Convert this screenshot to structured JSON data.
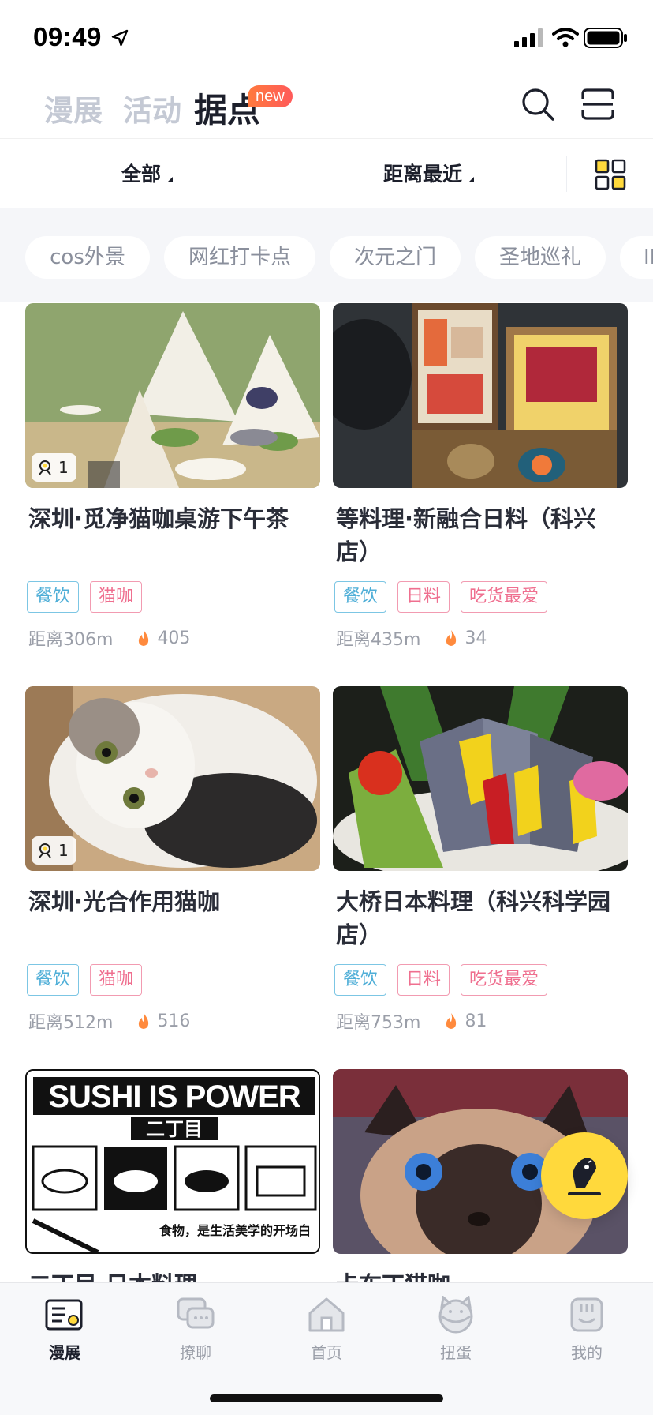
{
  "status_bar": {
    "time": "09:49"
  },
  "top_nav": {
    "tabs": [
      {
        "label": "漫展"
      },
      {
        "label": "活动"
      },
      {
        "label": "据点"
      }
    ],
    "new_badge": "new"
  },
  "filters": {
    "category": "全部",
    "sort": "距离最近"
  },
  "chips": [
    "cos外景",
    "网红打卡点",
    "次元之门",
    "圣地巡礼",
    "IP"
  ],
  "cards": [
    {
      "title": "深圳·觅净猫咖桌游下午茶",
      "badge": "1",
      "tags": [
        "餐饮",
        "猫咖"
      ],
      "distance": "距离306m",
      "heat": "405"
    },
    {
      "title": "等料理·新融合日料（科兴店）",
      "badge": "",
      "tags": [
        "餐饮",
        "日料",
        "吃货最爱"
      ],
      "distance": "距离435m",
      "heat": "34"
    },
    {
      "title": "深圳·光合作用猫咖",
      "badge": "1",
      "tags": [
        "餐饮",
        "猫咖"
      ],
      "distance": "距离512m",
      "heat": "516"
    },
    {
      "title": "大桥日本料理（科兴科学园店）",
      "badge": "",
      "tags": [
        "餐饮",
        "日料",
        "吃货最爱"
      ],
      "distance": "距离753m",
      "heat": "81"
    },
    {
      "title": "二丁目·日本料理",
      "badge": "",
      "image_text": "SUSHI IS POWER",
      "image_sub": "二丁目",
      "image_caption": "食物，是生活美学的开场白",
      "tags": [],
      "distance": "",
      "heat": ""
    },
    {
      "title": "卡布丁猫咖",
      "badge": "",
      "tags": [],
      "distance": "",
      "heat": ""
    }
  ],
  "tab_bar": {
    "items": [
      {
        "label": "漫展",
        "icon": "manzhan-icon"
      },
      {
        "label": "撩聊",
        "icon": "chat-icon"
      },
      {
        "label": "首页",
        "icon": "home-icon"
      },
      {
        "label": "扭蛋",
        "icon": "gacha-icon"
      },
      {
        "label": "我的",
        "icon": "profile-icon"
      }
    ]
  },
  "colors": {
    "accent": "#ffd93c",
    "tag_blue": "#4eaed7",
    "tag_pink": "#ef6f8f",
    "new_badge": "#ff5a5a"
  }
}
